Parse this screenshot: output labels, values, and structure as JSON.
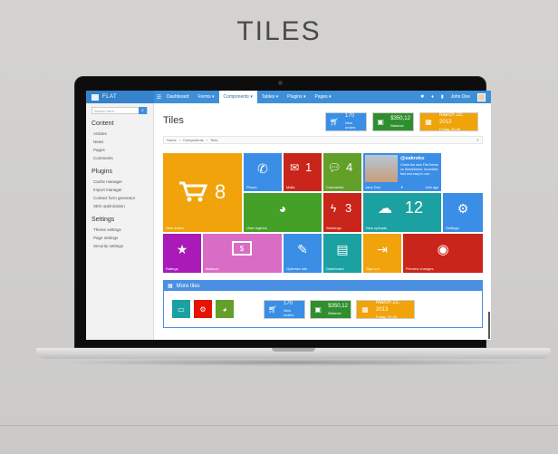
{
  "page": {
    "heading": "TILES"
  },
  "navbar": {
    "brand": "FLAT",
    "items": [
      {
        "label": "Dashboard"
      },
      {
        "label": "Forms ▾"
      },
      {
        "label": "Components ▾"
      },
      {
        "label": "Tables ▾"
      },
      {
        "label": "Plugins ▾"
      },
      {
        "label": "Pages ▾"
      }
    ],
    "user": "John Doe"
  },
  "sidebar": {
    "search_placeholder": "Search here...",
    "sections": [
      {
        "title": "Content",
        "links": [
          "Articles",
          "News",
          "Pages",
          "Comments"
        ]
      },
      {
        "title": "Plugins",
        "links": [
          "Cache manager",
          "Import manager",
          "Contact form generator",
          "SEO optimization"
        ]
      },
      {
        "title": "Settings",
        "links": [
          "Theme settings",
          "Page settings",
          "Security settings"
        ]
      }
    ]
  },
  "main": {
    "title": "Tiles",
    "stats": [
      {
        "value": "170",
        "label": "New orders"
      },
      {
        "value": "$350,12",
        "label": "Balance"
      },
      {
        "value": "March 22, 2013",
        "label": "Friday, 20:49"
      }
    ],
    "breadcrumb": [
      "Home",
      "Components",
      "Tiles"
    ],
    "tiles": {
      "new_orders": {
        "count": "8",
        "label": "New orders"
      },
      "phone": {
        "label": "Phone"
      },
      "mails": {
        "count": "1",
        "label": "Mails"
      },
      "comments": {
        "count": "4",
        "label": "Comments"
      },
      "profile": {
        "name": "Jane Doe",
        "handle": "@eakroko",
        "tweet": "Check the new Flat theme on themeforest. Incredible fast and easy to use.",
        "time": "1min ago"
      },
      "user_regions": {
        "label": "User regions"
      },
      "warnings": {
        "count": "3",
        "label": "Warnings"
      },
      "new_uploads": {
        "count": "12",
        "label": "New uploads"
      },
      "settings": {
        "label": "Settings"
      },
      "ratings": {
        "label": "Ratings"
      },
      "balance": {
        "label": "Balance"
      },
      "optimize": {
        "label": "Optimize site"
      },
      "dashboard": {
        "label": "Dashboard"
      },
      "sign_out": {
        "label": "Sign out"
      },
      "preview": {
        "label": "Preview changes"
      }
    },
    "more_tiles": {
      "title": "More tiles",
      "stats": [
        {
          "value": "170",
          "label": "New orders"
        },
        {
          "value": "$350,12",
          "label": "Balance"
        },
        {
          "value": "March 22, 2013",
          "label": "Friday, 20:49"
        }
      ]
    }
  },
  "colors": {
    "blue": "#4a90e2",
    "orange": "#f0a30a",
    "red": "#e51400",
    "green": "#60a917",
    "darkgreen": "#45a028",
    "teal": "#1ba1a2",
    "purple": "#a91ab8",
    "pink": "#d96cc4",
    "brightgreen": "#3aa757",
    "darkred": "#c9251a",
    "olive": "#62a02a",
    "lime": "#7bc11c"
  }
}
